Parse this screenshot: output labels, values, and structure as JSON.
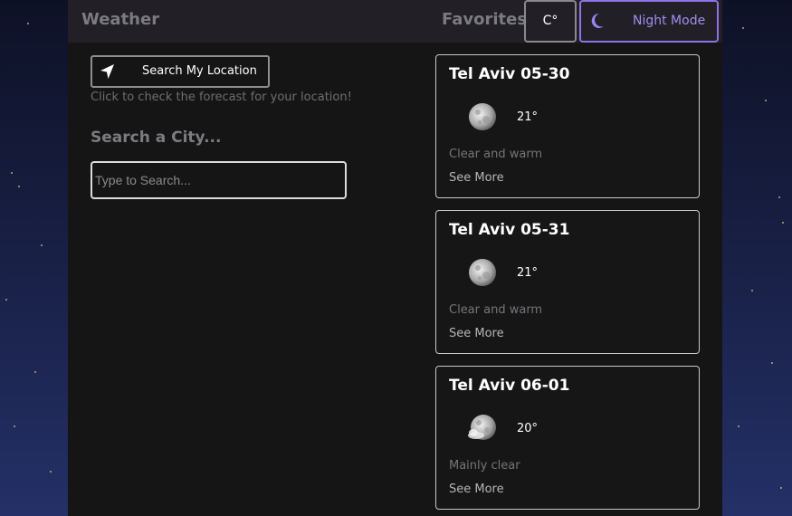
{
  "header": {
    "brand": "Weather",
    "favorites_label": "Favorites",
    "unit_label": "C°",
    "mode_label": "Night Mode"
  },
  "location": {
    "button_label": "Search My Location",
    "hint": "Click to check the forecast for your location!"
  },
  "search": {
    "title": "Search a City...",
    "placeholder": "Type to Search..."
  },
  "forecast": [
    {
      "title": "Tel Aviv 05-30",
      "temperature": "21°",
      "description": "Clear and warm",
      "link": "See More",
      "icon": "moon-clear-icon"
    },
    {
      "title": "Tel Aviv 05-31",
      "temperature": "21°",
      "description": "Clear and warm",
      "link": "See More",
      "icon": "moon-clear-icon"
    },
    {
      "title": "Tel Aviv 06-01",
      "temperature": "20°",
      "description": "Mainly clear",
      "link": "See More",
      "icon": "moon-partly-cloudy-icon"
    }
  ],
  "colors": {
    "accent": "#8f72e8",
    "panel": "#151515",
    "topbar": "#221f26"
  }
}
